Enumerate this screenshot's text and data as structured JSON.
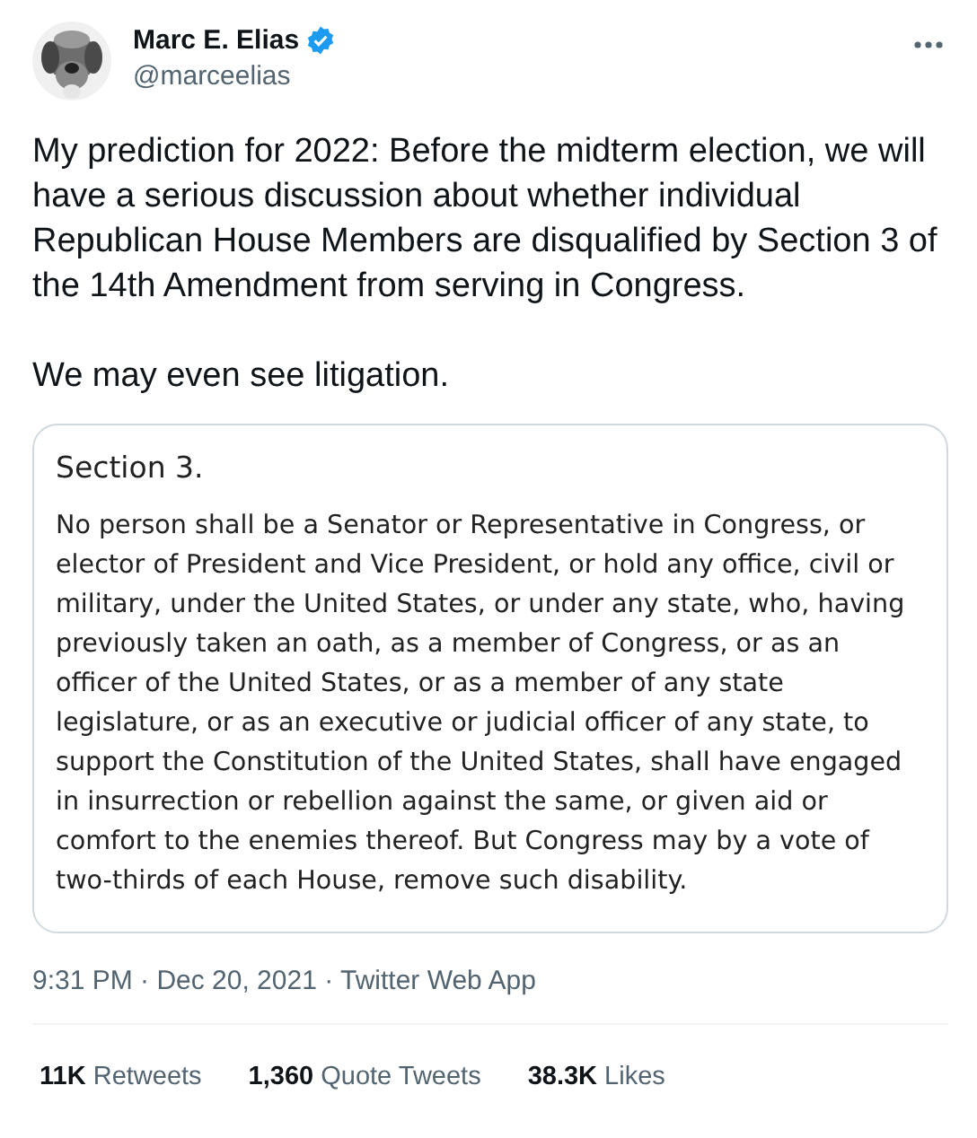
{
  "author": {
    "name": "Marc E. Elias",
    "verified": true,
    "handle": "@marceelias"
  },
  "text": [
    "My prediction for 2022: Before the midterm election, we will have a serious discussion about whether individual Republican House Members are disqualified by Section 3 of the 14th Amendment from serving in Congress.",
    "We may even see litigation."
  ],
  "card": {
    "heading": "Section 3.",
    "body": "No person shall be a Senator or Representative in Congress, or elector of President and Vice President, or hold any office, civil or military, under the United States, or under any state, who, having previously taken an oath, as a member of Congress, or as an officer of the United States, or as a member of any state legislature, or as an executive or judicial officer of any state, to support the Constitution of the United States, shall have engaged in insurrection or rebellion against the same, or given aid or comfort to the enemies thereof. But Congress may by a vote of two-thirds of each House, remove such disability."
  },
  "meta": "9:31 PM · Dec 20, 2021 · Twitter Web App",
  "stats": [
    {
      "count": "11K",
      "label": "Retweets"
    },
    {
      "count": "1,360",
      "label": "Quote Tweets"
    },
    {
      "count": "38.3K",
      "label": "Likes"
    }
  ]
}
